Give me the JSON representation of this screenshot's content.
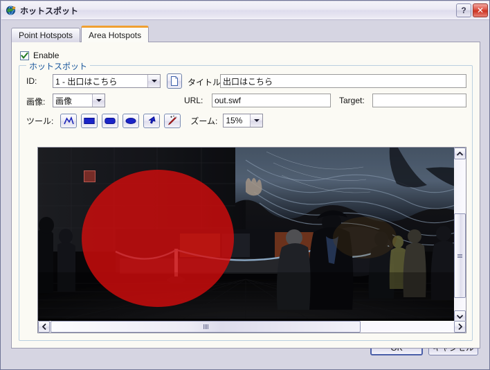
{
  "window": {
    "title": "ホットスポット",
    "app_icon": "globe-icon",
    "help_button": "?",
    "close_button": "✕"
  },
  "tabs": [
    {
      "label": "Point Hotspots",
      "active": false
    },
    {
      "label": "Area Hotspots",
      "active": true
    }
  ],
  "enable": {
    "label": "Enable",
    "checked": true
  },
  "groupbox": {
    "title": "ホットスポット"
  },
  "fields": {
    "id_label": "ID:",
    "id_value": "1 - 出口はこちら",
    "new_button_icon": "new-document-icon",
    "title_label": "タイトル:",
    "title_value": "出口はこちら",
    "image_label": "画像:",
    "image_value": "画像",
    "url_label": "URL:",
    "url_value": "out.swf",
    "target_label": "Target:",
    "target_value": ""
  },
  "toolbar": {
    "tools_label": "ツール:",
    "tools": [
      {
        "name": "polygon-tool",
        "icon": "polyline-icon"
      },
      {
        "name": "rectangle-tool",
        "icon": "rectangle-icon"
      },
      {
        "name": "rounded-rectangle-tool",
        "icon": "rounded-rectangle-icon"
      },
      {
        "name": "ellipse-tool",
        "icon": "ellipse-icon"
      },
      {
        "name": "select-tool",
        "icon": "arrow-cursor-icon"
      },
      {
        "name": "magic-wand-tool",
        "icon": "magic-wand-icon"
      }
    ],
    "zoom_label": "ズーム:",
    "zoom_value": "15%"
  },
  "canvas": {
    "hotspot_shape": "ellipse",
    "hotspot_color": "#d60c0c",
    "vertical_scrollbar": {
      "up": "▲",
      "down": "▼"
    },
    "horizontal_scrollbar": {
      "left": "◀",
      "right": "▶"
    }
  },
  "footer": {
    "ok_label": "OK",
    "cancel_label": "キャンセル"
  },
  "colors": {
    "accent_tab": "#f0a030",
    "group_title": "#14539a",
    "window_bg": "#d6d5e2",
    "panel_bg": "#fbfaf4"
  }
}
